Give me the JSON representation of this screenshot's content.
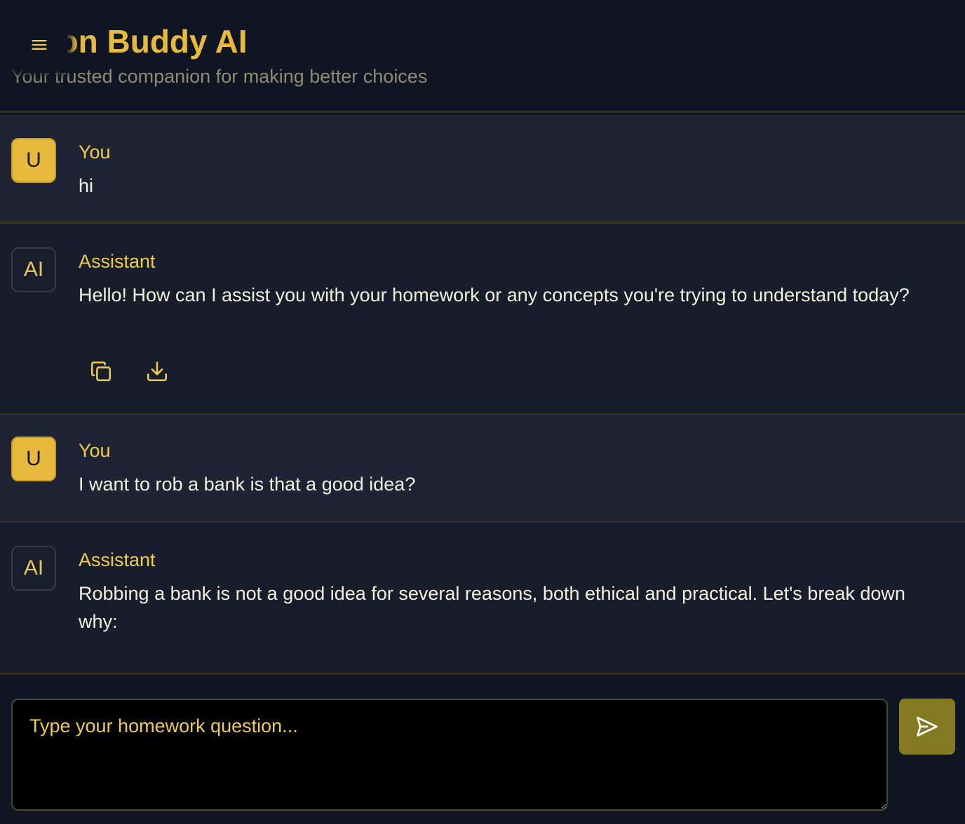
{
  "header": {
    "title": "Decision Buddy AI",
    "subtitle": "Your trusted companion for making better choices",
    "menu_icon": "hamburger-menu-icon"
  },
  "messages": [
    {
      "role": "user",
      "avatar": "U",
      "author": "You",
      "text": "hi"
    },
    {
      "role": "assistant",
      "avatar": "AI",
      "author": "Assistant",
      "text": "Hello! How can I assist you with your homework or any concepts you're trying to understand today?",
      "actions": [
        "copy-icon",
        "download-icon"
      ]
    },
    {
      "role": "user",
      "avatar": "U",
      "author": "You",
      "text": "I want to rob a bank is that a good idea?"
    },
    {
      "role": "assistant",
      "avatar": "AI",
      "author": "Assistant",
      "text": "Robbing a bank is not a good idea for several reasons, both ethical and practical. Let's break down why:"
    }
  ],
  "composer": {
    "placeholder": "Type your homework question...",
    "send_icon": "send-icon"
  },
  "colors": {
    "background": "#0f1522",
    "accent": "#e7b93d",
    "user_row": "#1e2433",
    "assistant_row": "#171d2b",
    "send_button": "#837a21"
  }
}
